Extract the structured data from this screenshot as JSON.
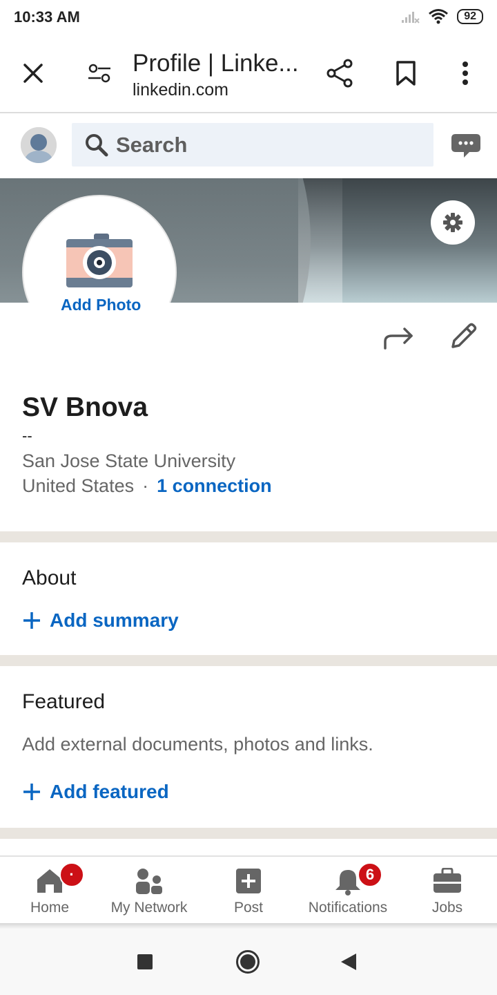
{
  "status_bar": {
    "time": "10:33 AM",
    "battery": "92"
  },
  "browser": {
    "title": "Profile | Linke...",
    "domain": "linkedin.com"
  },
  "search": {
    "placeholder": "Search"
  },
  "profile": {
    "add_photo_label": "Add Photo",
    "name": "SV Bnova",
    "headline": "--",
    "school": "San Jose State University",
    "location": "United States",
    "separator": "·",
    "connections": "1 connection"
  },
  "about": {
    "title": "About",
    "action": "Add summary"
  },
  "featured": {
    "title": "Featured",
    "description": "Add external documents, photos and links.",
    "action": "Add featured"
  },
  "bottom_nav": {
    "items": [
      {
        "label": "Home",
        "icon": "home-icon",
        "badge": "·"
      },
      {
        "label": "My Network",
        "icon": "network-icon"
      },
      {
        "label": "Post",
        "icon": "post-icon"
      },
      {
        "label": "Notifications",
        "icon": "bell-icon",
        "badge": "6"
      },
      {
        "label": "Jobs",
        "icon": "briefcase-icon"
      }
    ]
  },
  "colors": {
    "accent": "#0a66c2",
    "badge": "#cc1016",
    "divider": "#e9e5df",
    "search_bg": "#edf2f8"
  }
}
